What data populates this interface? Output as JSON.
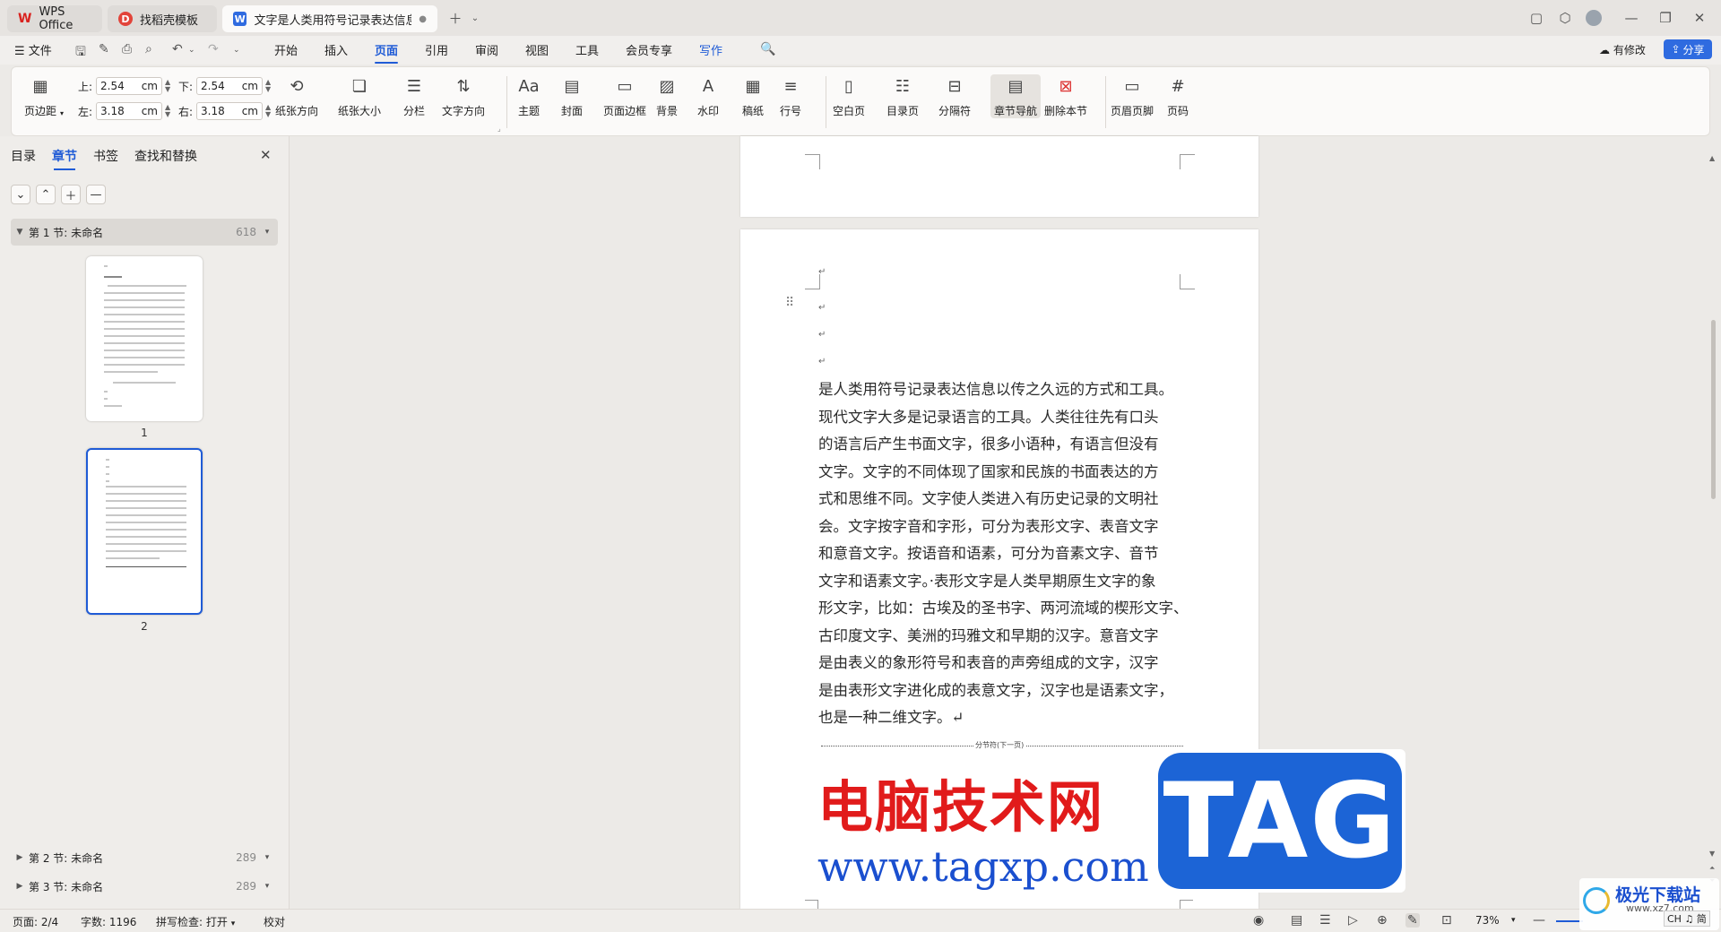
{
  "tabs": [
    {
      "label": "WPS Office",
      "icon": "wps-logo-icon"
    },
    {
      "label": "找稻壳模板",
      "icon": "docer-icon"
    },
    {
      "label": "文字是人类用符号记录表达信息以",
      "icon": "word-doc-icon"
    }
  ],
  "menu": {
    "file_label": "文件",
    "items": [
      "开始",
      "插入",
      "页面",
      "引用",
      "审阅",
      "视图",
      "工具",
      "会员专享",
      "写作"
    ],
    "active_index": 2,
    "right_status": "有修改",
    "share_label": "分享"
  },
  "ribbon": {
    "margins_label": "页边距",
    "margins": {
      "top_label": "上:",
      "top_value": "2.54",
      "bottom_label": "下:",
      "bottom_value": "2.54",
      "left_label": "左:",
      "left_value": "3.18",
      "right_label": "右:",
      "right_value": "3.18",
      "unit": "cm"
    },
    "group1": [
      "纸张方向",
      "纸张大小",
      "分栏",
      "文字方向"
    ],
    "group2": [
      "主题",
      "封面",
      "页面边框",
      "背景",
      "水印",
      "稿纸",
      "行号"
    ],
    "group3": [
      "空白页",
      "目录页",
      "分隔符",
      "章节导航",
      "删除本节"
    ],
    "group4": [
      "页眉页脚",
      "页码"
    ]
  },
  "nav": {
    "tabs": [
      "目录",
      "章节",
      "书签",
      "查找和替换"
    ],
    "active_tab": 1,
    "sections": [
      {
        "title": "第 1 节: 未命名",
        "count": "618",
        "open": true
      },
      {
        "title": "第 2 节: 未命名",
        "count": "289",
        "open": false
      },
      {
        "title": "第 3 节: 未命名",
        "count": "289",
        "open": false
      }
    ],
    "pages": [
      "1",
      "2"
    ],
    "selected_page": 2
  },
  "document": {
    "paragraph": "是人类用符号记录表达信息以传之久远的方式和工具。现代文字大多是记录语言的工具。人类往往先有口头的语言后产生书面文字，很多小语种，有语言但没有文字。文字的不同体现了国家和民族的书面表达的方式和思维不同。文字使人类进入有历史记录的文明社会。文字按字音和字形，可分为表形文字、表音文字和意音文字。按语音和语素，可分为音素文字、音节文字和语素文字。·表形文字是人类早期原生文字的象形文字，比如：古埃及的圣书字、两河流域的楔形文字、古印度文字、美洲的玛雅文和早期的汉字。意音文字是由表义的象形符号和表音的声旁组成的文字，汉字是由表形文字进化成的表意文字，汉字也是语素文字，也是一种二维文字。↵",
    "paragraph_lines": [
      "是人类用符号记录表达信息以传之久远的方式和工具。",
      "现代文字大多是记录语言的工具。人类往往先有口头",
      "的语言后产生书面文字，很多小语种，有语言但没有",
      "文字。文字的不同体现了国家和民族的书面表达的方",
      "式和思维不同。文字使人类进入有历史记录的文明社",
      "会。文字按字音和字形，可分为表形文字、表音文字",
      "和意音文字。按语音和语素，可分为音素文字、音节",
      "文字和语素文字。·表形文字是人类早期原生文字的象",
      "形文字，比如：古埃及的圣书字、两河流域的楔形文字、",
      "古印度文字、美洲的玛雅文和早期的汉字。意音文字",
      "是由表义的象形符号和表音的声旁组成的文字，汉字",
      "是由表形文字进化成的表意文字，汉字也是语素文字，",
      "也是一种二维文字。↵"
    ],
    "section_break_label": "分节符(下一页)",
    "paragraph_mark": "↵"
  },
  "watermark": {
    "cn": "电脑技术网",
    "url": "www.tagxp.com",
    "tag": "TAG"
  },
  "status": {
    "page": "页面: 2/4",
    "words": "字数: 1196",
    "spell": "拼写检查: 打开",
    "proof": "校对",
    "zoom": "73%"
  },
  "brand": {
    "name": "极光下载站",
    "url": "www.xz7.com",
    "ime": "CH ♫ 简"
  },
  "colors": {
    "accent": "#1f5bd6",
    "watermark_red": "#e11b1b",
    "watermark_blue": "#1a4fcf",
    "tag_blue": "#1c64d6"
  }
}
